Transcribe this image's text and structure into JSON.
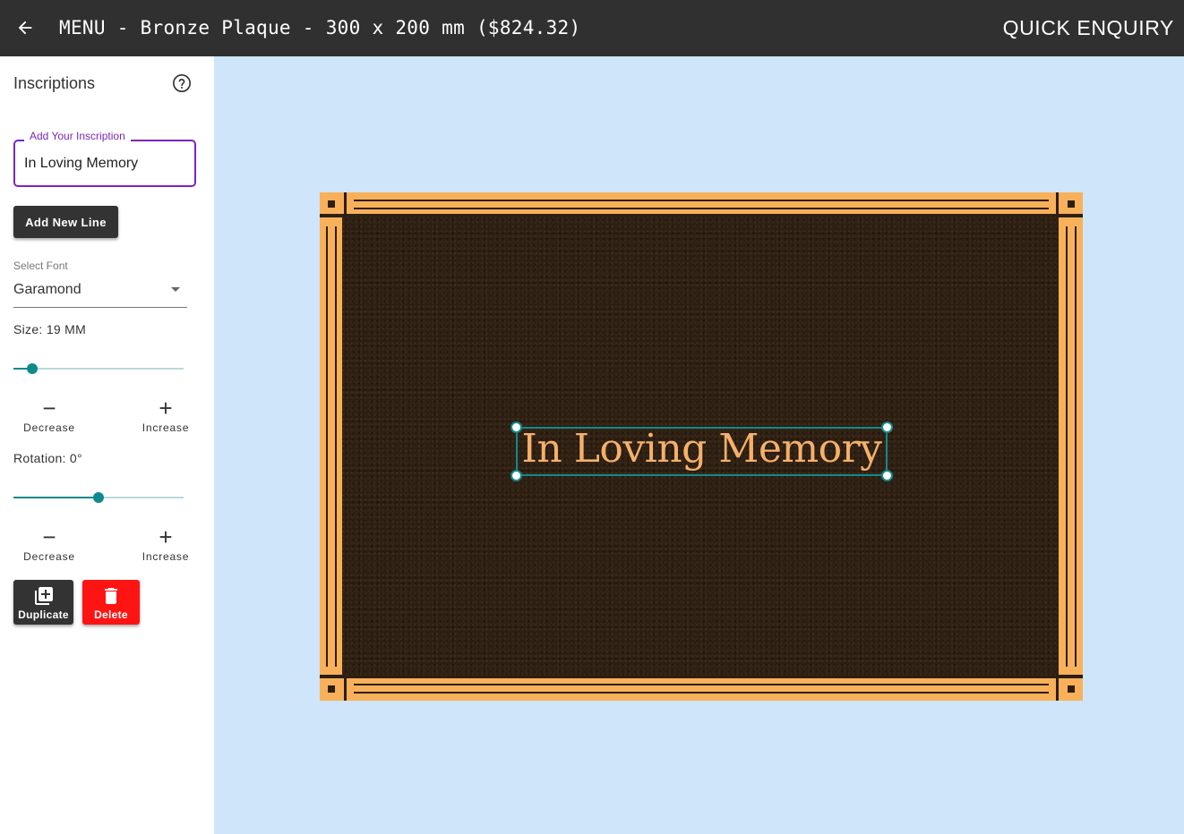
{
  "header": {
    "title": "MENU - Bronze Plaque - 300 x 200 mm ($824.32)",
    "enquiry_label": "QUICK ENQUIRY"
  },
  "sidebar": {
    "title": "Inscriptions",
    "inscription_field": {
      "label": "Add Your Inscription",
      "value": "In Loving Memory"
    },
    "add_line_label": "Add New Line",
    "font_select": {
      "label": "Select Font",
      "value": "Garamond"
    },
    "size": {
      "label": "Size: 19 MM",
      "slider_fraction": 0.11,
      "decrease_label": "Decrease",
      "increase_label": "Increase"
    },
    "rotation": {
      "label": "Rotation: 0°",
      "slider_fraction": 0.5,
      "decrease_label": "Decrease",
      "increase_label": "Increase"
    },
    "duplicate_label": "Duplicate",
    "delete_label": "Delete"
  },
  "plaque": {
    "inscription_text": "In Loving Memory"
  },
  "colors": {
    "topbar": "#303030",
    "accent_purple": "#7b25b9",
    "accent_teal": "#0e8a8c",
    "delete_red": "#ff1414",
    "bronze_gold": "#f8b15a",
    "bronze_dark": "#2d1e10",
    "canvas_bg": "#cfe5f9"
  },
  "icons": {
    "back": "arrow-left-icon",
    "help": "help-circle-icon",
    "dropdown": "caret-down-icon",
    "duplicate": "library-add-icon",
    "delete": "trash-icon"
  }
}
